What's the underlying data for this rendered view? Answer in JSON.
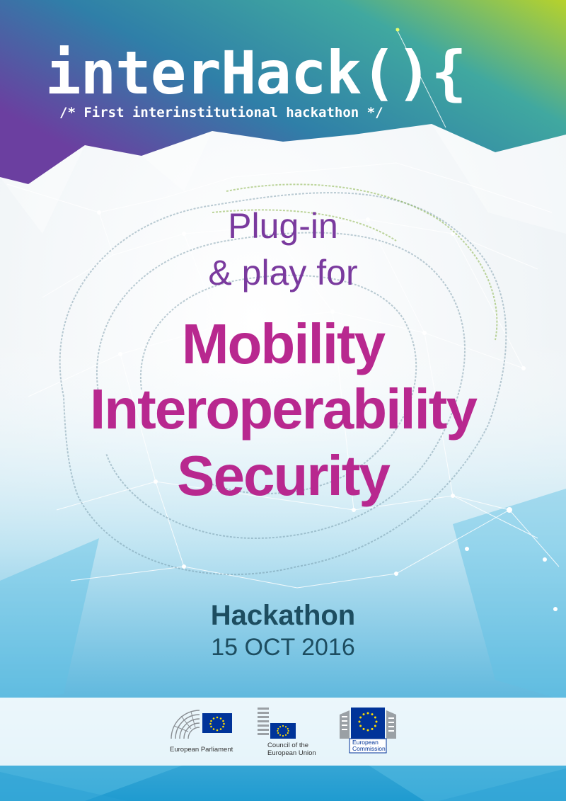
{
  "header": {
    "title": "interHack(){",
    "subtitle": "/* First interinstitutional hackathon */"
  },
  "tagline": {
    "line1": "Plug-in",
    "line2": "& play for"
  },
  "topics": [
    "Mobility",
    "Interoperability",
    "Security"
  ],
  "event": {
    "label": "Hackathon",
    "date": "15 OCT 2016"
  },
  "logos": {
    "ep": {
      "name": "European Parliament"
    },
    "council": {
      "line1": "Council of the",
      "line2": "European Union"
    },
    "commission": {
      "line1": "European",
      "line2": "Commission"
    }
  },
  "colors": {
    "purple": "#7a3a9e",
    "magenta": "#b8288f",
    "teal_text": "#1d4d60",
    "lime": "#b3cf2a",
    "eu_blue": "#003399",
    "eu_gold": "#ffdd00"
  }
}
